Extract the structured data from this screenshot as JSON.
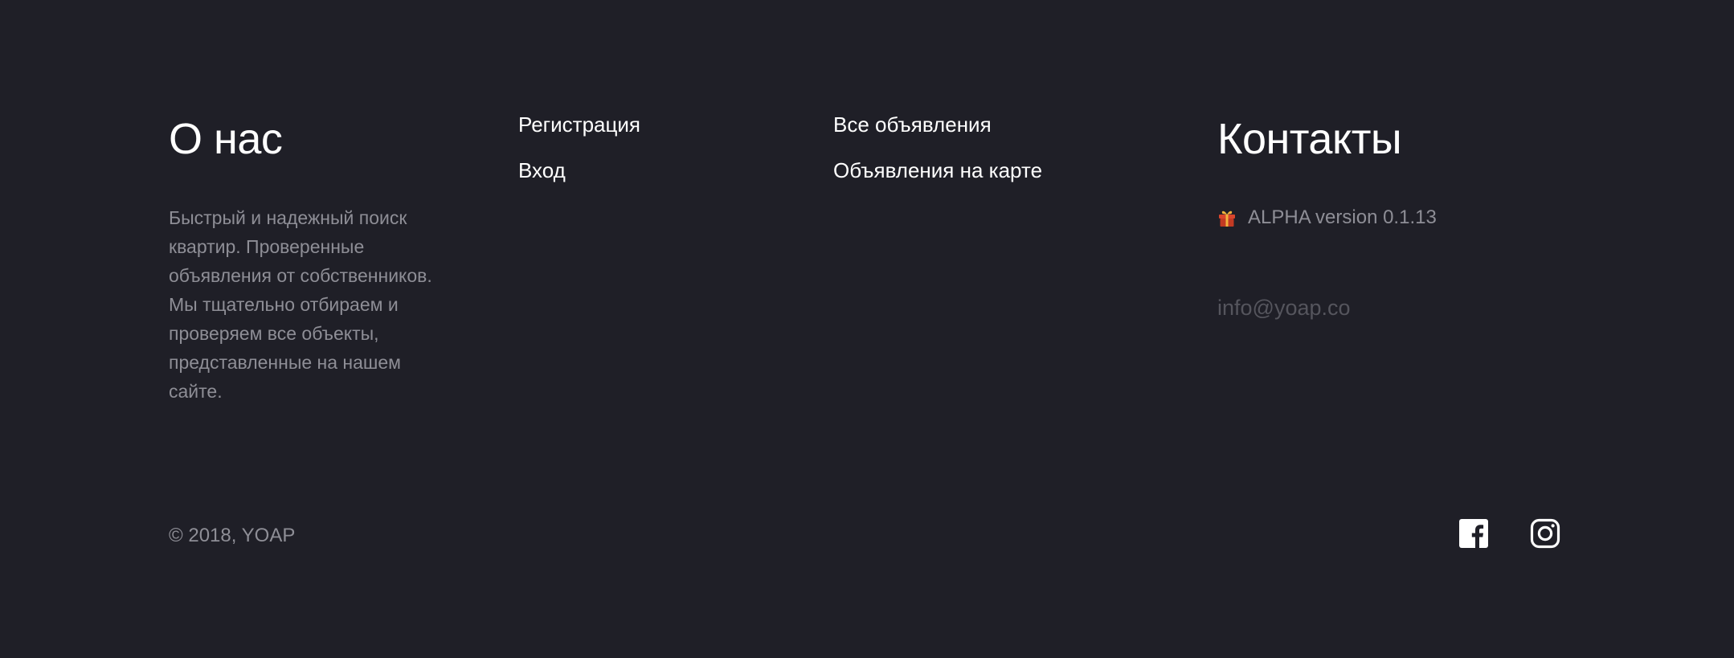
{
  "about": {
    "title": "О нас",
    "text": "Быстрый и надежный поиск квартир. Проверенные объявления от собственников. Мы тщательно отбираем и проверяем все объекты, представленные на нашем сайте."
  },
  "nav_account": [
    {
      "label": "Регистрация"
    },
    {
      "label": "Вход"
    }
  ],
  "nav_listings": [
    {
      "label": "Все объявления"
    },
    {
      "label": "Объявления на карте"
    }
  ],
  "contacts": {
    "title": "Контакты",
    "version_icon": "gift-icon",
    "version": "ALPHA version 0.1.13",
    "email": "info@yoap.co"
  },
  "copyright": "© 2018, YOAP",
  "social": [
    {
      "icon": "facebook-icon"
    },
    {
      "icon": "instagram-icon"
    }
  ],
  "colors": {
    "background": "#1f1f27",
    "text_primary": "#ffffff",
    "text_muted": "#8e8e96",
    "email": "#55555d",
    "gift_red": "#d9452c",
    "gift_gold": "#f2b33d"
  }
}
